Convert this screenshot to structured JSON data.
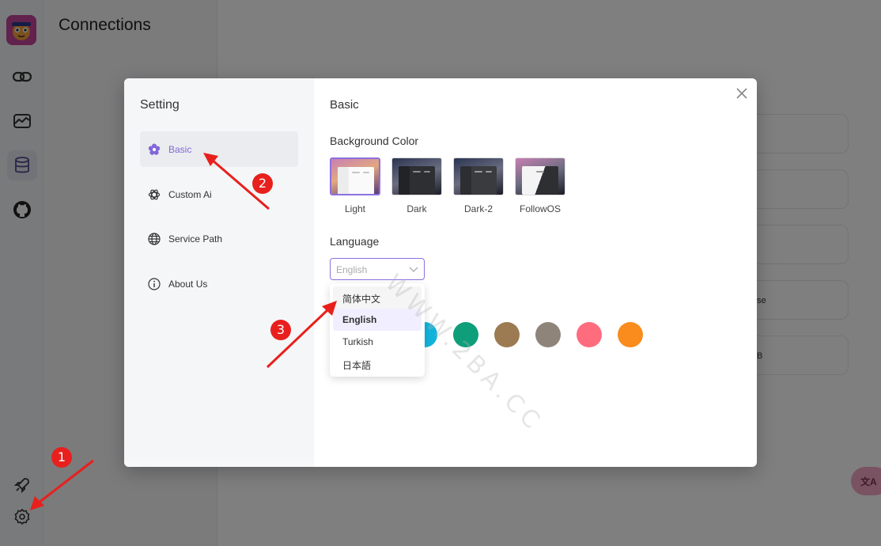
{
  "background": {
    "panel_title": "Connections",
    "rail_icons": [
      "link-icon",
      "chart-icon",
      "database-icon",
      "github-icon",
      "rocket-icon",
      "gear-icon"
    ],
    "cards": [
      {
        "text": ""
      },
      {
        "text": ""
      },
      {
        "text": ""
      },
      {
        "text": "se"
      },
      {
        "text": "B"
      }
    ],
    "translate_button": "文A"
  },
  "dialog": {
    "title": "Setting",
    "nav": [
      {
        "label": "Basic",
        "icon": "flower-icon",
        "active": true
      },
      {
        "label": "Custom Ai",
        "icon": "openai-icon",
        "active": false
      },
      {
        "label": "Service Path",
        "icon": "globe-icon",
        "active": false
      },
      {
        "label": "About Us",
        "icon": "info-icon",
        "active": false
      }
    ],
    "content": {
      "heading": "Basic",
      "background_color_label": "Background Color",
      "themes": [
        {
          "label": "Light",
          "selected": true
        },
        {
          "label": "Dark",
          "selected": false
        },
        {
          "label": "Dark-2",
          "selected": false
        },
        {
          "label": "FollowOS",
          "selected": false
        }
      ],
      "language_label": "Language",
      "language_value": "English",
      "language_options": [
        {
          "label": "简体中文",
          "state": "hover"
        },
        {
          "label": "English",
          "state": "selected"
        },
        {
          "label": "Turkish",
          "state": ""
        },
        {
          "label": "日本語",
          "state": ""
        }
      ],
      "accent_colors": [
        "#12b3db",
        "#0e9e7a",
        "#9c7a52",
        "#8e8479",
        "#fe6c7e",
        "#f98c1c"
      ]
    }
  },
  "annotations": {
    "badges": [
      "1",
      "2",
      "3"
    ],
    "arrow_color": "#e8201d"
  },
  "watermark": "WWW.2BA.CC"
}
